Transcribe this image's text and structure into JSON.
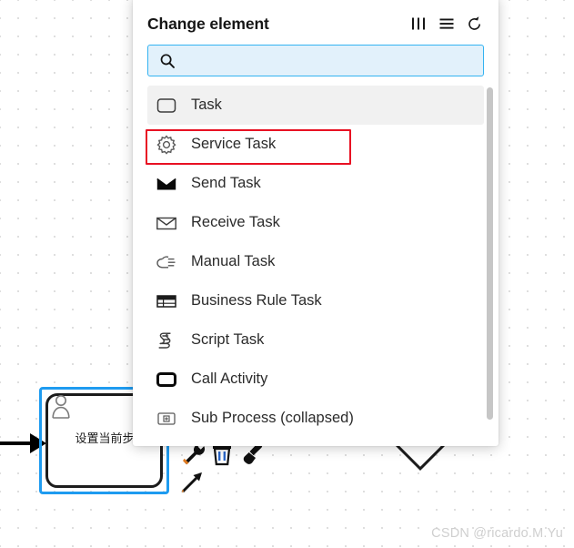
{
  "panel": {
    "title": "Change element",
    "header_icons": [
      {
        "name": "columns-icon",
        "glyph": "columns"
      },
      {
        "name": "list-icon",
        "glyph": "list"
      },
      {
        "name": "reset-icon",
        "glyph": "reset"
      }
    ],
    "search": {
      "value": "",
      "placeholder": "",
      "icon": "search-icon"
    },
    "items": [
      {
        "label": "Task",
        "icon": "task-icon",
        "highlighted": true,
        "annotated": false
      },
      {
        "label": "Service Task",
        "icon": "gear-icon",
        "highlighted": false,
        "annotated": true
      },
      {
        "label": "Send Task",
        "icon": "envelope-filled-icon",
        "highlighted": false,
        "annotated": false
      },
      {
        "label": "Receive Task",
        "icon": "envelope-outline-icon",
        "highlighted": false,
        "annotated": false
      },
      {
        "label": "Manual Task",
        "icon": "hand-icon",
        "highlighted": false,
        "annotated": false
      },
      {
        "label": "Business Rule Task",
        "icon": "table-icon",
        "highlighted": false,
        "annotated": false
      },
      {
        "label": "Script Task",
        "icon": "script-icon",
        "highlighted": false,
        "annotated": false
      },
      {
        "label": "Call Activity",
        "icon": "call-activity-icon",
        "highlighted": false,
        "annotated": false
      },
      {
        "label": "Sub Process (collapsed)",
        "icon": "subprocess-plus-icon",
        "highlighted": false,
        "annotated": false
      }
    ],
    "scrollbar": {
      "visible": true
    }
  },
  "canvas": {
    "node": {
      "label": "设置当前步",
      "type": "user-task",
      "selected": true
    },
    "gateway": {
      "type": "exclusive-gateway"
    },
    "context_pad": [
      {
        "name": "wrench-icon",
        "label": "wrench"
      },
      {
        "name": "trash-icon",
        "label": "delete"
      },
      {
        "name": "brush-icon",
        "label": "brush"
      },
      {
        "name": "connect-arrow-icon",
        "label": "connect"
      }
    ]
  },
  "watermark": {
    "text": "CSDN @ricardo.M.Yu"
  },
  "colors": {
    "annotation_red": "#e81123",
    "search_border": "#34b3f1",
    "search_bg": "#e2f1fb",
    "selection_blue": "#1e9bf0",
    "row_highlight": "#f1f1f1",
    "watermark_gray": "#cfcfcf"
  }
}
